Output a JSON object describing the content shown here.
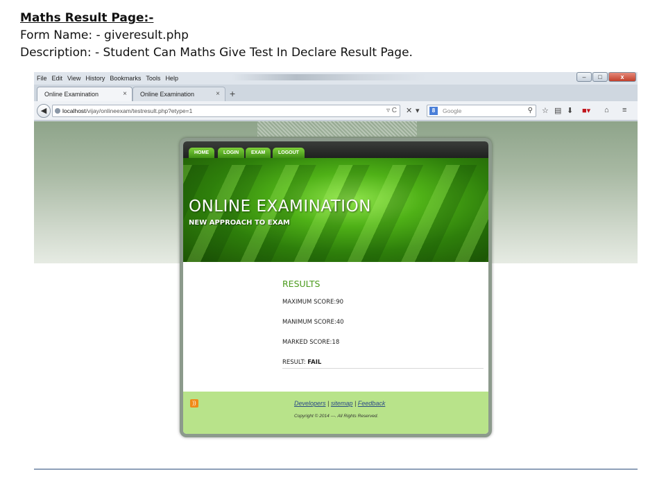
{
  "slide": {
    "title": "Maths Result Page:-",
    "form_name": "Form Name: - giveresult.php",
    "description": "Description: - Student Can Maths Give Test In Declare Result Page."
  },
  "browser": {
    "menu": [
      "File",
      "Edit",
      "View",
      "History",
      "Bookmarks",
      "Tools",
      "Help"
    ],
    "tabs": [
      {
        "label": "Online Examination",
        "active": true
      },
      {
        "label": "Online Examination",
        "active": false
      }
    ],
    "url": {
      "host": "localhost",
      "path": "/vijay/onlineexam/testresult.php?etype=1"
    },
    "search_placeholder": "Google"
  },
  "site": {
    "nav": [
      "HOME",
      "LOGIN",
      "EXAM",
      "LOGOUT"
    ],
    "banner_title": "ONLINE EXAMINATION",
    "banner_subtitle": "NEW APPROACH TO EXAM",
    "results": {
      "heading": "RESULTS",
      "maximum_score": "MAXIMUM SCORE:90",
      "minimum_score": "MANIMUM SCORE:40",
      "marked_score": "MARKED SCORE:18",
      "result_label": "RESULT:",
      "result_value": "FAIL"
    },
    "footer": {
      "links": [
        "Developers",
        "sitemap",
        "Feedback"
      ],
      "separator": "|",
      "copyright": "Copyright © 2014 ---. All Rights Reserved."
    }
  },
  "colors": {
    "accent_green": "#4a9a1c",
    "footer_bg": "#b8e38a",
    "nav_button": "#5fb02a"
  }
}
